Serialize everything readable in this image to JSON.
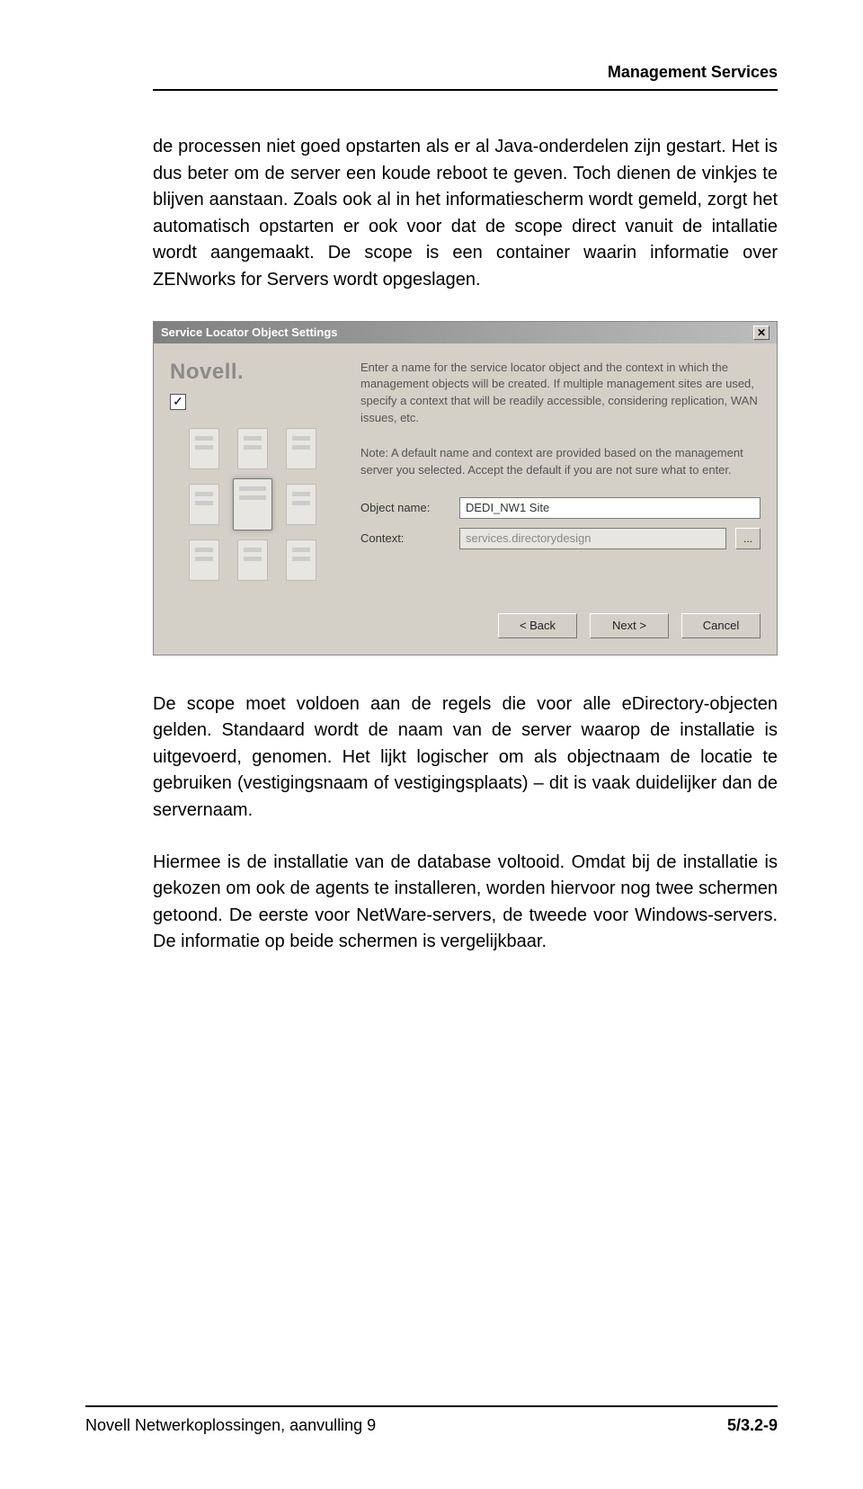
{
  "header": {
    "title": "Management Services"
  },
  "paragraphs": {
    "p1": "de processen niet goed opstarten als er al Java-onderdelen zijn gestart. Het is dus beter om de server een koude reboot te geven. Toch dienen de vinkjes te blijven aanstaan. Zoals ook al in het informatiescherm wordt gemeld, zorgt het automatisch opstarten er ook voor dat de scope direct vanuit de intallatie wordt aangemaakt. De scope is een container waarin informatie over ZENworks for Servers wordt opgeslagen.",
    "p2": "De scope moet voldoen aan de regels die voor alle eDirectory-objecten gelden. Standaard wordt de naam van de server waarop de installatie is uitgevoerd, genomen. Het lijkt logischer om als objectnaam de locatie te gebruiken (vestigingsnaam of vestigingsplaats) – dit is vaak duidelijker dan de servernaam.",
    "p3": "Hiermee is de installatie van de database voltooid. Omdat bij de installatie is gekozen om ook de agents te installeren, worden hiervoor nog twee schermen getoond. De eerste voor NetWare-servers, de tweede voor Windows-servers. De informatie op beide schermen is vergelijkbaar."
  },
  "dialog": {
    "title": "Service Locator Object Settings",
    "brand": "Novell.",
    "checkmark": "✓",
    "desc1": "Enter a name for the service locator object and the context in which the management objects will be created. If multiple management sites are used, specify a context that will be readily accessible, considering replication, WAN issues, etc.",
    "desc2": "Note: A default name and context are provided based on the management server you selected. Accept the default if you are not sure what to enter.",
    "object_label": "Object name:",
    "object_value": "DEDI_NW1 Site",
    "context_label": "Context:",
    "context_value": "services.directorydesign",
    "browse": "...",
    "back": "< Back",
    "next": "Next >",
    "cancel": "Cancel"
  },
  "footer": {
    "left": "Novell Netwerkoplossingen, aanvulling 9",
    "right": "5/3.2-9"
  }
}
